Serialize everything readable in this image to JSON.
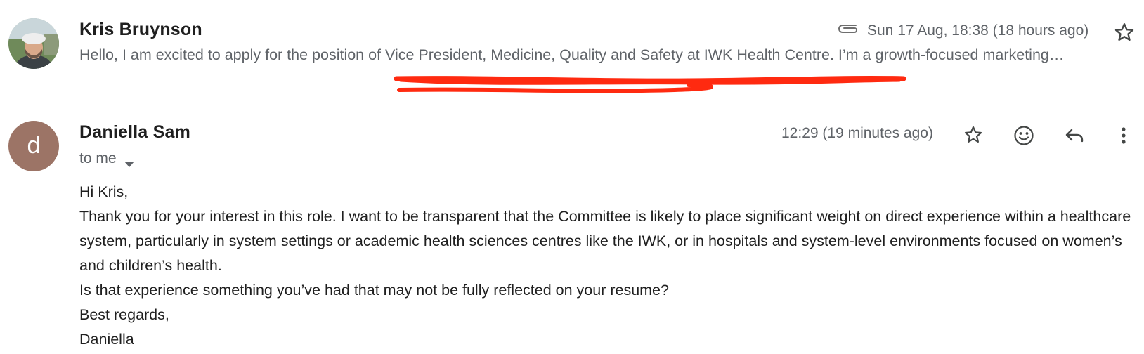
{
  "collapsed_message": {
    "sender": "Kris Bruynson",
    "date": "Sun 17 Aug, 18:38 (18 hours ago)",
    "snippet": "Hello, I am excited to apply for the position of Vice President, Medicine, Quality and Safety at IWK Health Centre. I’m a growth-focused marketing…",
    "has_attachment": true,
    "icons": {
      "attachment": "paperclip-icon",
      "star": "star-outline-icon"
    }
  },
  "annotation": {
    "color": "#ff2a10"
  },
  "expanded_message": {
    "avatar_letter": "d",
    "avatar_color": "#9c7466",
    "sender": "Daniella Sam",
    "recipients": "to me",
    "date": "12:29 (19 minutes ago)",
    "icons": {
      "star": "star-outline-icon",
      "emoji": "emoji-reaction-icon",
      "reply": "reply-icon",
      "more": "more-vertical-icon",
      "details": "caret-down-icon"
    },
    "body": {
      "greeting": "Hi Kris,",
      "paragraph1": "Thank you for your interest in this role. I want to be transparent that the Committee is likely to place significant weight on direct experience within a healthcare system, particularly in system settings or academic health sciences centres like the IWK, or in hospitals and system-level environments focused on women’s and children’s health.",
      "paragraph2": "Is that experience something you’ve had that may not be fully reflected on your resume?",
      "signoff": "Best regards,",
      "signature": "Daniella"
    }
  }
}
